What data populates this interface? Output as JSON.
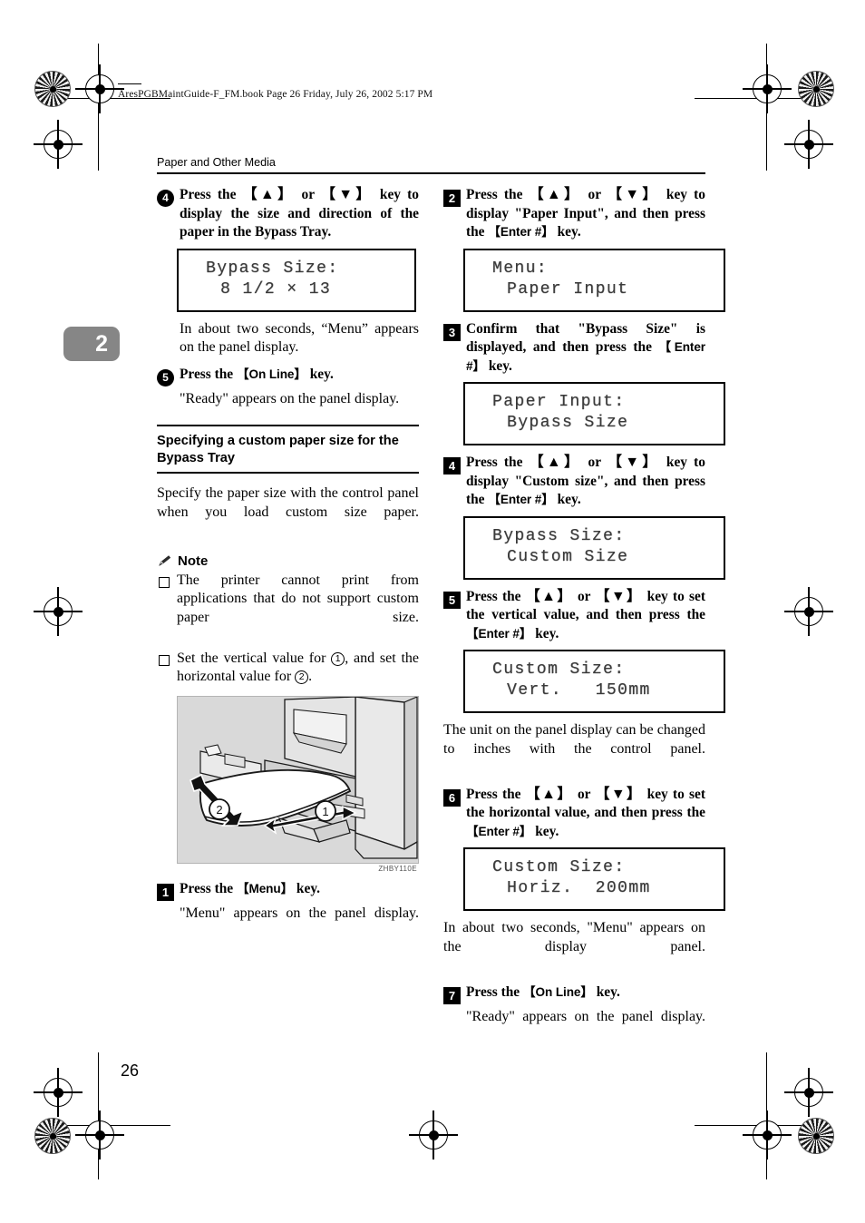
{
  "file_header": "AresPGBMaintGuide-F_FM.book  Page 26  Friday, July 26, 2002  5:17 PM",
  "running_head": "Paper and Other Media",
  "chapter_tab": "2",
  "page_number": "26",
  "figure_code": "ZHBY110E",
  "colors": {
    "chapter_tab_bg": "#868686",
    "figure_bg": "#d9d9d9",
    "lcd_text": "#3a3a3a"
  },
  "left_column": {
    "step4": {
      "badge": "4",
      "text_1": "Press the ",
      "key_up": "【▲】",
      "text_2": " or ",
      "key_down": "【▼】",
      "text_3": " key to display the size and direction of the paper in the Bypass Tray."
    },
    "lcd_bypass_size": {
      "line1": "Bypass Size:",
      "line2": "8 1/2 × 13"
    },
    "para_menu_appears": "In about two seconds, “Menu” appears on the panel display.",
    "step5": {
      "badge": "5",
      "text_1": "Press the ",
      "key": "【On Line】",
      "text_2": " key."
    },
    "para_ready": "\"Ready\" appears on the panel display.",
    "section_heading": "Specifying a custom paper size for the Bypass Tray",
    "para_specify": "Specify the paper size with the control panel when you load custom size paper.",
    "note_label": "Note",
    "note_items": [
      "The printer cannot print from applications that do not support custom paper size.",
      "Set the vertical value for ①, and set the horizontal value for ②."
    ],
    "note_item2_parts": {
      "a": "Set the vertical value for ",
      "c1": "1",
      "b": ", and set the horizontal value for ",
      "c2": "2",
      "d": "."
    },
    "step1": {
      "badge": "1",
      "text_1": "Press the ",
      "key": "【Menu】",
      "text_2": " key."
    },
    "para_menu_display": "\"Menu\" appears on the panel display."
  },
  "right_column": {
    "step2": {
      "badge": "2",
      "text_1": "Press the ",
      "key_up": "【▲】",
      "text_2": " or ",
      "key_down": "【▼】",
      "text_3": " key to display \"Paper Input\", and then press the ",
      "key_enter": "【Enter #】",
      "text_4": " key."
    },
    "lcd_menu": {
      "line1": "Menu:",
      "line2": "Paper Input"
    },
    "step3": {
      "badge": "3",
      "text_1": "Confirm that \"Bypass Size\" is displayed, and then press the ",
      "key_enter": "【Enter #】",
      "text_2": " key."
    },
    "lcd_paper_input": {
      "line1": "Paper Input:",
      "line2": "Bypass Size"
    },
    "step4": {
      "badge": "4",
      "text_1": "Press the ",
      "key_up": "【▲】",
      "text_2": " or ",
      "key_down": "【▼】",
      "text_3": " key to display \"Custom size\", and then press the ",
      "key_enter": "【Enter #】",
      "text_4": " key."
    },
    "lcd_bypass_custom": {
      "line1": "Bypass Size:",
      "line2": "Custom Size"
    },
    "step5": {
      "badge": "5",
      "text_1": "Press the ",
      "key_up": "【▲】",
      "text_2": " or ",
      "key_down": "【▼】",
      "text_3": " key to set the vertical value, and then press the ",
      "key_enter": "【Enter #】",
      "text_4": " key."
    },
    "lcd_vert": {
      "line1": "Custom Size:",
      "line2": "Vert.   150mm"
    },
    "para_unit": "The unit on the panel display can be changed to inches with the control panel.",
    "step6": {
      "badge": "6",
      "text_1": "Press the ",
      "key_up": "【▲】",
      "text_2": " or ",
      "key_down": "【▼】",
      "text_3": " key to set the horizontal value, and then press the ",
      "key_enter": "【Enter #】",
      "text_4": " key."
    },
    "lcd_horiz": {
      "line1": "Custom Size:",
      "line2": "Horiz.  200mm"
    },
    "para_menu_appears": "In about two seconds, \"Menu\" appears on the display panel.",
    "step7": {
      "badge": "7",
      "text_1": "Press the ",
      "key": "【On Line】",
      "text_2": " key."
    },
    "para_ready": "\"Ready\" appears on the panel display."
  }
}
